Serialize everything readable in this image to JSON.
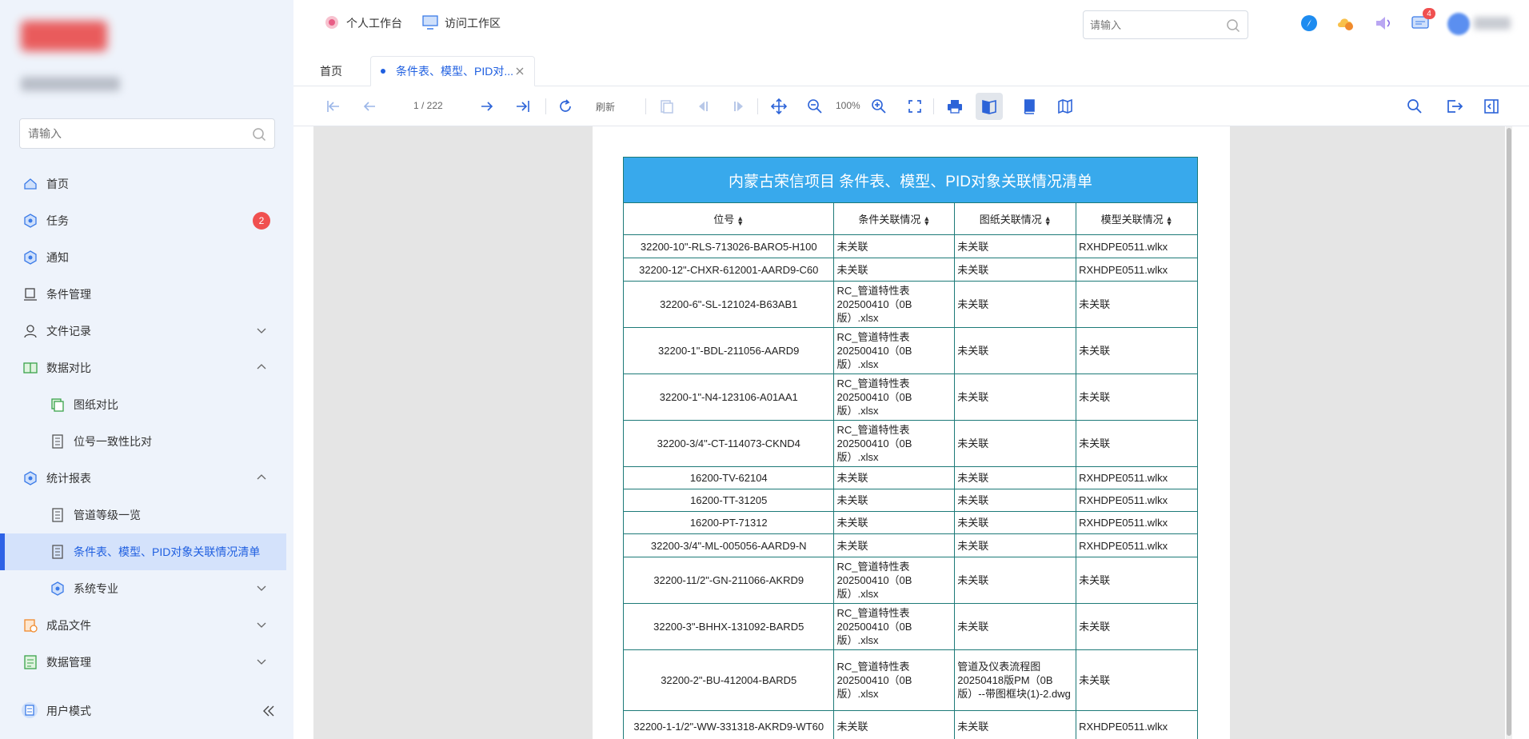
{
  "sidebar": {
    "search_placeholder": "请输入",
    "items": [
      {
        "label": "首页"
      },
      {
        "label": "任务",
        "badge": "2"
      },
      {
        "label": "通知"
      },
      {
        "label": "条件管理"
      },
      {
        "label": "文件记录"
      },
      {
        "label": "数据对比"
      },
      {
        "label": "图纸对比"
      },
      {
        "label": "位号一致性比对"
      },
      {
        "label": "统计报表"
      },
      {
        "label": "管道等级一览"
      },
      {
        "label": "条件表、模型、PID对象关联情况清单"
      },
      {
        "label": "系统专业"
      },
      {
        "label": "成品文件"
      },
      {
        "label": "数据管理"
      }
    ],
    "user_mode": "用户模式"
  },
  "header": {
    "workbench": "个人工作台",
    "visit_area": "访问工作区",
    "search_placeholder": "请输入",
    "message_badge": "4"
  },
  "tabs": [
    {
      "label": "首页"
    },
    {
      "label": "条件表、模型、PID对..."
    }
  ],
  "toolbar": {
    "page_indicator": "1 / 222",
    "refresh": "刷新",
    "zoom": "100%"
  },
  "report": {
    "title": "内蒙古荣信项目  条件表、模型、PID对象关联情况清单",
    "columns": [
      "位号",
      "条件关联情况",
      "图纸关联情况",
      "模型关联情况"
    ],
    "rows": [
      [
        "32200-10\"-RLS-713026-BARO5-H100",
        "未关联",
        "未关联",
        "RXHDPE0511.wlkx"
      ],
      [
        "32200-12\"-CHXR-612001-AARD9-C60",
        "未关联",
        "未关联",
        "RXHDPE0511.wlkx"
      ],
      [
        "32200-6\"-SL-121024-B63AB1",
        "RC_管道特性表202500410（0B版）.xlsx",
        "未关联",
        "未关联"
      ],
      [
        "32200-1\"-BDL-211056-AARD9",
        "RC_管道特性表202500410（0B版）.xlsx",
        "未关联",
        "未关联"
      ],
      [
        "32200-1\"-N4-123106-A01AA1",
        "RC_管道特性表202500410（0B版）.xlsx",
        "未关联",
        "未关联"
      ],
      [
        "32200-3/4\"-CT-114073-CKND4",
        "RC_管道特性表202500410（0B版）.xlsx",
        "未关联",
        "未关联"
      ],
      [
        "16200-TV-62104",
        "未关联",
        "未关联",
        "RXHDPE0511.wlkx"
      ],
      [
        "16200-TT-31205",
        "未关联",
        "未关联",
        "RXHDPE0511.wlkx"
      ],
      [
        "16200-PT-71312",
        "未关联",
        "未关联",
        "RXHDPE0511.wlkx"
      ],
      [
        "32200-3/4\"-ML-005056-AARD9-N",
        "未关联",
        "未关联",
        "RXHDPE0511.wlkx"
      ],
      [
        "32200-11/2\"-GN-211066-AKRD9",
        "RC_管道特性表202500410（0B版）.xlsx",
        "未关联",
        "未关联"
      ],
      [
        "32200-3\"-BHHX-131092-BARD5",
        "RC_管道特性表202500410（0B版）.xlsx",
        "未关联",
        "未关联"
      ],
      [
        "32200-2\"-BU-412004-BARD5",
        "RC_管道特性表202500410（0B版）.xlsx",
        "管道及仪表流程图20250418版PM（0B版）--带图框块(1)-2.dwg",
        "未关联"
      ],
      [
        "32200-1-1/2\"-WW-331318-AKRD9-WT60",
        "未关联",
        "未关联",
        "RXHDPE0511.wlkx"
      ]
    ]
  }
}
